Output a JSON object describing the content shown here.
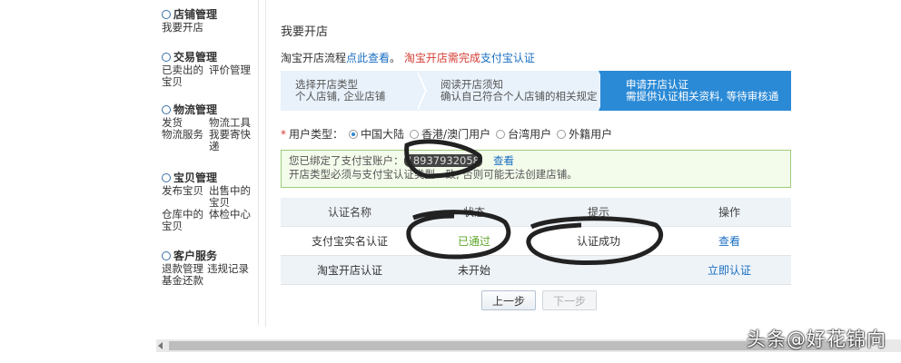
{
  "sidebar": {
    "sections": [
      {
        "title": "店铺管理",
        "icon": "shop-icon",
        "links": [
          "我要开店"
        ]
      },
      {
        "title": "交易管理",
        "icon": "trade-icon",
        "links": [
          "已卖出的宝贝",
          "评价管理"
        ]
      },
      {
        "title": "物流管理",
        "icon": "logistics-icon",
        "links": [
          "发货",
          "物流工具",
          "物流服务",
          "我要寄快递"
        ]
      },
      {
        "title": "宝贝管理",
        "icon": "goods-icon",
        "links": [
          "发布宝贝",
          "出售中的宝贝",
          "仓库中的宝贝",
          "体检中心"
        ]
      },
      {
        "title": "客户服务",
        "icon": "service-icon",
        "links": [
          "退款管理",
          "违规记录",
          "基金还款"
        ]
      }
    ]
  },
  "main": {
    "title": "我要开店",
    "flow_prefix": "淘宝开店流程",
    "flow_link": "点此查看",
    "flow_suffix": "。",
    "warn_text": "淘宝开店需完成",
    "warn_link": "支付宝认证",
    "steps": [
      {
        "title": "选择开店类型",
        "desc": "个人店铺, 企业店铺"
      },
      {
        "title": "阅读开店须知",
        "desc": "确认自己符合个人店铺的相关规定"
      },
      {
        "title": "申请开店认证",
        "desc": "需提供认证相关资料, 等待审核通"
      }
    ],
    "user_type_label": "用户类型：",
    "user_type_options": [
      "中国大陆",
      "香港/澳门用户",
      "台湾用户",
      "外籍用户"
    ],
    "bind_text": "您已绑定了支付宝账户：",
    "account": "18937932058",
    "view_link": "查看",
    "bind_note": "开店类型必须与支付宝认证类型一致, 否则可能无法创建店铺。",
    "table": {
      "headers": [
        "认证名称",
        "状态",
        "提示",
        "操作"
      ],
      "rows": [
        {
          "name": "支付宝实名认证",
          "status": "已通过",
          "tip": "认证成功",
          "action": "查看"
        },
        {
          "name": "淘宝开店认证",
          "status": "未开始",
          "tip": "",
          "action": "立即认证"
        }
      ]
    },
    "prev_button": "上一步",
    "next_button": "下一步"
  },
  "watermark": "头条@好花锦向",
  "colors": {
    "accent": "#2b8ad6",
    "link": "#1a6fc2",
    "warn": "#d43c33",
    "success": "#5ea628"
  }
}
